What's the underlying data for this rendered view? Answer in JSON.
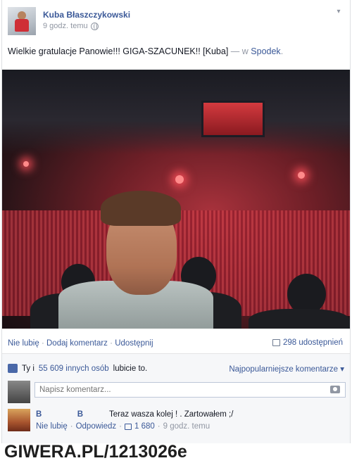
{
  "post": {
    "author": "Kuba Błaszczykowski",
    "timestamp": "9 godz. temu",
    "privacy_icon": "globe-icon",
    "text": "Wielkie gratulacje Panowie!!! GIGA-SZACUNEK!! [Kuba]",
    "location_sep": "— w",
    "location": "Spodek",
    "location_end": "."
  },
  "actions": {
    "unlike": "Nie lubię",
    "comment": "Dodaj komentarz",
    "share": "Udostępnij",
    "shares_count": "298 udostępnień"
  },
  "feedback": {
    "likes_you": "Ty i",
    "likes_others": "55 609 innych osób",
    "likes_suffix": "lubicie to.",
    "sort_label": "Najpopularniejsze komentarze",
    "compose_placeholder": "Napisz komentarz..."
  },
  "comment": {
    "author_first": "B",
    "author_last": "B",
    "text": "Teraz wasza kolej ! . Zartowałem ;/",
    "unlike": "Nie lubię",
    "reply": "Odpowiedz",
    "like_count": "1 680",
    "time": "9 godz. temu"
  },
  "watermark": "GIWERA.PL/1213026e",
  "colors": {
    "link": "#3b5998",
    "text": "#141823",
    "muted": "#9197a3",
    "feedback_bg": "#f6f7f9"
  }
}
